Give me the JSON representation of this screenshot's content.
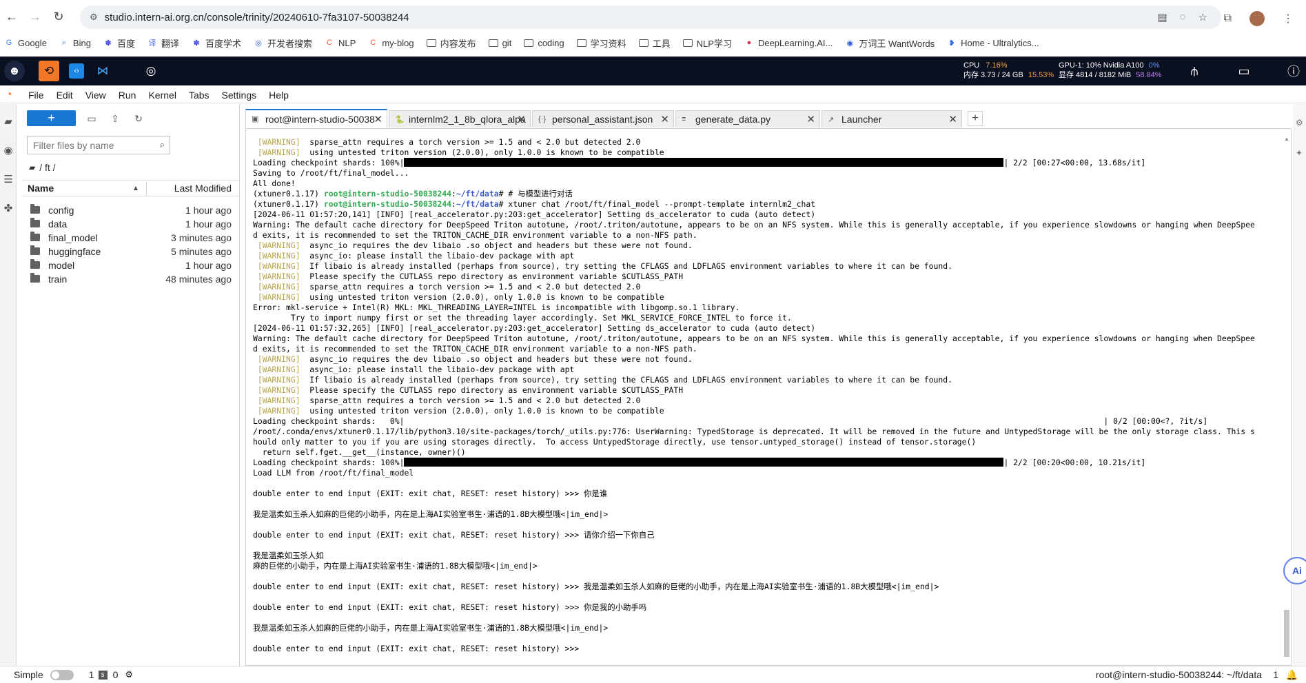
{
  "browser": {
    "url": "studio.intern-ai.org.cn/console/trinity/20240610-7fa3107-50038244",
    "bookmarks": [
      {
        "label": "Google",
        "icon": "google-icon",
        "color": "#4285f4",
        "glyph": "G"
      },
      {
        "label": "Bing",
        "icon": "search-icon",
        "color": "#1a73e8",
        "glyph": "⌕"
      },
      {
        "label": "百度",
        "icon": "baidu-paw-icon",
        "color": "#2932e1",
        "glyph": "✽"
      },
      {
        "label": "翻译",
        "icon": "translate-icon",
        "color": "#4a6cf7",
        "glyph": "译"
      },
      {
        "label": "百度学术",
        "icon": "baidu-paw-icon",
        "color": "#2932e1",
        "glyph": "✽"
      },
      {
        "label": "开发者搜索",
        "icon": "dev-search-icon",
        "color": "#2c5bd9",
        "glyph": "◎"
      },
      {
        "label": "NLP",
        "icon": "csdn-icon",
        "color": "#fc5531",
        "glyph": "C"
      },
      {
        "label": "my-blog",
        "icon": "csdn-icon",
        "color": "#fc5531",
        "glyph": "C"
      },
      {
        "label": "内容发布",
        "icon": "folder-icon"
      },
      {
        "label": "git",
        "icon": "folder-icon"
      },
      {
        "label": "coding",
        "icon": "folder-icon"
      },
      {
        "label": "学习资料",
        "icon": "folder-icon"
      },
      {
        "label": "工具",
        "icon": "folder-icon"
      },
      {
        "label": "NLP学习",
        "icon": "folder-icon"
      },
      {
        "label": "DeepLearning.AI...",
        "icon": "deeplearning-icon",
        "color": "#e0314a",
        "glyph": "●"
      },
      {
        "label": "万词王 WantWords",
        "icon": "wantwords-icon",
        "color": "#2c5bd9",
        "glyph": "◉"
      },
      {
        "label": "Home - Ultralytics...",
        "icon": "ultralytics-icon",
        "color": "#2f6fe8",
        "glyph": "❥"
      }
    ]
  },
  "studio": {
    "cpu_label": "CPU",
    "cpu_pct": "7.16%",
    "mem_label": "内存 3.73 / 24 GB",
    "mem_pct": "15.53%",
    "gpu_label": "GPU-1: 10% Nvidia A100",
    "gpu_pct": "0%",
    "vram_label": "显存 4814 / 8182 MiB",
    "vram_pct": "58.84%"
  },
  "menu": [
    "File",
    "Edit",
    "View",
    "Run",
    "Kernel",
    "Tabs",
    "Settings",
    "Help"
  ],
  "filebrowser": {
    "new_label": "+",
    "filter_placeholder": "Filter files by name",
    "breadcrumb": "/ ft /",
    "col_name": "Name",
    "col_modified": "Last Modified",
    "rows": [
      {
        "name": "config",
        "modified": "1 hour ago"
      },
      {
        "name": "data",
        "modified": "1 hour ago"
      },
      {
        "name": "final_model",
        "modified": "3 minutes ago"
      },
      {
        "name": "huggingface",
        "modified": "5 minutes ago"
      },
      {
        "name": "model",
        "modified": "1 hour ago"
      },
      {
        "name": "train",
        "modified": "48 minutes ago"
      }
    ]
  },
  "tabs": [
    {
      "label": "root@intern-studio-50038",
      "icon": "terminal-icon",
      "glyph": "▣",
      "active": true,
      "width": 206
    },
    {
      "label": "internlm2_1_8b_qlora_alpa",
      "icon": "python-file-icon",
      "glyph": "🐍",
      "active": false,
      "width": 206
    },
    {
      "label": "personal_assistant.json",
      "icon": "json-file-icon",
      "glyph": "{·}",
      "active": false,
      "width": 206
    },
    {
      "label": "generate_data.py",
      "icon": "text-file-icon",
      "glyph": "≡",
      "active": false,
      "width": 210
    },
    {
      "label": "Launcher",
      "icon": "launcher-icon",
      "glyph": "↗",
      "active": false,
      "width": 204
    }
  ],
  "terminal": {
    "lines": [
      [
        {
          "w": " [WARNING] "
        },
        {
          "t": " sparse_attn requires a torch version >= 1.5 and < 2.0 but detected 2.0"
        }
      ],
      [
        {
          "w": " [WARNING] "
        },
        {
          "t": " using untested triton version (2.0.0), only 1.0.0 is known to be compatible"
        }
      ],
      [
        {
          "t": "Loading checkpoint shards: 100%|"
        },
        {
          "bar": 870
        },
        {
          "t": "| 2/2 [00:27<00:00, 13.68s/it]"
        }
      ],
      [
        {
          "t": "Saving to /root/ft/final_model..."
        }
      ],
      [
        {
          "t": "All done!"
        }
      ],
      [
        {
          "t": "(xtuner0.1.17) "
        },
        {
          "g": "root@intern-studio-50038244"
        },
        {
          "t": ":"
        },
        {
          "b": "~/ft/data"
        },
        {
          "t": "# # 与模型进行对话"
        }
      ],
      [
        {
          "t": "(xtuner0.1.17) "
        },
        {
          "g": "root@intern-studio-50038244"
        },
        {
          "t": ":"
        },
        {
          "b": "~/ft/data"
        },
        {
          "t": "# xtuner chat /root/ft/final_model --prompt-template internlm2_chat"
        }
      ],
      [
        {
          "t": "[2024-06-11 01:57:20,141] [INFO] [real_accelerator.py:203:get_accelerator] Setting ds_accelerator to cuda (auto detect)"
        }
      ],
      [
        {
          "t": "Warning: The default cache directory for DeepSpeed Triton autotune, /root/.triton/autotune, appears to be on an NFS system. While this is generally acceptable, if you experience slowdowns or hanging when DeepSpee"
        }
      ],
      [
        {
          "t": "d exits, it is recommended to set the TRITON_CACHE_DIR environment variable to a non-NFS path."
        }
      ],
      [
        {
          "w": " [WARNING] "
        },
        {
          "t": " async_io requires the dev libaio .so object and headers but these were not found."
        }
      ],
      [
        {
          "w": " [WARNING] "
        },
        {
          "t": " async_io: please install the libaio-dev package with apt"
        }
      ],
      [
        {
          "w": " [WARNING] "
        },
        {
          "t": " If libaio is already installed (perhaps from source), try setting the CFLAGS and LDFLAGS environment variables to where it can be found."
        }
      ],
      [
        {
          "w": " [WARNING] "
        },
        {
          "t": " Please specify the CUTLASS repo directory as environment variable $CUTLASS_PATH"
        }
      ],
      [
        {
          "w": " [WARNING] "
        },
        {
          "t": " sparse_attn requires a torch version >= 1.5 and < 2.0 but detected 2.0"
        }
      ],
      [
        {
          "w": " [WARNING] "
        },
        {
          "t": " using untested triton version (2.0.0), only 1.0.0 is known to be compatible"
        }
      ],
      [
        {
          "t": "Error: mkl-service + Intel(R) MKL: MKL_THREADING_LAYER=INTEL is incompatible with libgomp.so.1 library."
        }
      ],
      [
        {
          "t": "        Try to import numpy first or set the threading layer accordingly. Set MKL_SERVICE_FORCE_INTEL to force it."
        }
      ],
      [
        {
          "t": "[2024-06-11 01:57:32,265] [INFO] [real_accelerator.py:203:get_accelerator] Setting ds_accelerator to cuda (auto detect)"
        }
      ],
      [
        {
          "t": "Warning: The default cache directory for DeepSpeed Triton autotune, /root/.triton/autotune, appears to be on an NFS system. While this is generally acceptable, if you experience slowdowns or hanging when DeepSpee"
        }
      ],
      [
        {
          "t": "d exits, it is recommended to set the TRITON_CACHE_DIR environment variable to a non-NFS path."
        }
      ],
      [
        {
          "w": " [WARNING] "
        },
        {
          "t": " async_io requires the dev libaio .so object and headers but these were not found."
        }
      ],
      [
        {
          "w": " [WARNING] "
        },
        {
          "t": " async_io: please install the libaio-dev package with apt"
        }
      ],
      [
        {
          "w": " [WARNING] "
        },
        {
          "t": " If libaio is already installed (perhaps from source), try setting the CFLAGS and LDFLAGS environment variables to where it can be found."
        }
      ],
      [
        {
          "w": " [WARNING] "
        },
        {
          "t": " Please specify the CUTLASS repo directory as environment variable $CUTLASS_PATH"
        }
      ],
      [
        {
          "w": " [WARNING] "
        },
        {
          "t": " sparse_attn requires a torch version >= 1.5 and < 2.0 but detected 2.0"
        }
      ],
      [
        {
          "w": " [WARNING] "
        },
        {
          "t": " using untested triton version (2.0.0), only 1.0.0 is known to be compatible"
        }
      ],
      [
        {
          "t": "Loading checkpoint shards:   0%|                                                                                                                                                    | 0/2 [00:00<?, ?it/s]"
        }
      ],
      [
        {
          "t": "/root/.conda/envs/xtuner0.1.17/lib/python3.10/site-packages/torch/_utils.py:776: UserWarning: TypedStorage is deprecated. It will be removed in the future and UntypedStorage will be the only storage class. This s"
        }
      ],
      [
        {
          "t": "hould only matter to you if you are using storages directly.  To access UntypedStorage directly, use tensor.untyped_storage() instead of tensor.storage()"
        }
      ],
      [
        {
          "t": "  return self.fget.__get__(instance, owner)()"
        }
      ],
      [
        {
          "t": "Loading checkpoint shards: 100%|"
        },
        {
          "bar": 870
        },
        {
          "t": "| 2/2 [00:20<00:00, 10.21s/it]"
        }
      ],
      [
        {
          "t": "Load LLM from /root/ft/final_model"
        }
      ],
      [],
      [
        {
          "t": "double enter to end input (EXIT: exit chat, RESET: reset history) >>> 你是谁"
        }
      ],
      [],
      [
        {
          "t": "我是温柔如玉杀人如麻的巨佬的小助手，内在是上海AI实验室书生·浦语的1.8B大模型哦<|im_end|>"
        }
      ],
      [],
      [
        {
          "t": "double enter to end input (EXIT: exit chat, RESET: reset history) >>> 请你介绍一下你自己"
        }
      ],
      [],
      [
        {
          "t": "我是温柔如玉杀人如"
        }
      ],
      [
        {
          "t": "麻的巨佬的小助手，内在是上海AI实验室书生·浦语的1.8B大模型哦<|im_end|>"
        }
      ],
      [],
      [
        {
          "t": "double enter to end input (EXIT: exit chat, RESET: reset history) >>> 我是温柔如玉杀人如麻的巨佬的小助手，内在是上海AI实验室书生·浦语的1.8B大模型哦<|im_end|>"
        }
      ],
      [],
      [
        {
          "t": "double enter to end input (EXIT: exit chat, RESET: reset history) >>> 你是我的小助手吗"
        }
      ],
      [],
      [
        {
          "t": "我是温柔如玉杀人如麻的巨佬的小助手，内在是上海AI实验室书生·浦语的1.8B大模型哦<|im_end|>"
        }
      ],
      [],
      [
        {
          "t": "double enter to end input (EXIT: exit chat, RESET: reset history) >>> "
        }
      ]
    ]
  },
  "statusbar": {
    "mode": "Simple",
    "count1": "1",
    "count2": "0",
    "right": "root@intern-studio-50038244: ~/ft/data",
    "right_count": "1"
  },
  "float_button": "Ai"
}
